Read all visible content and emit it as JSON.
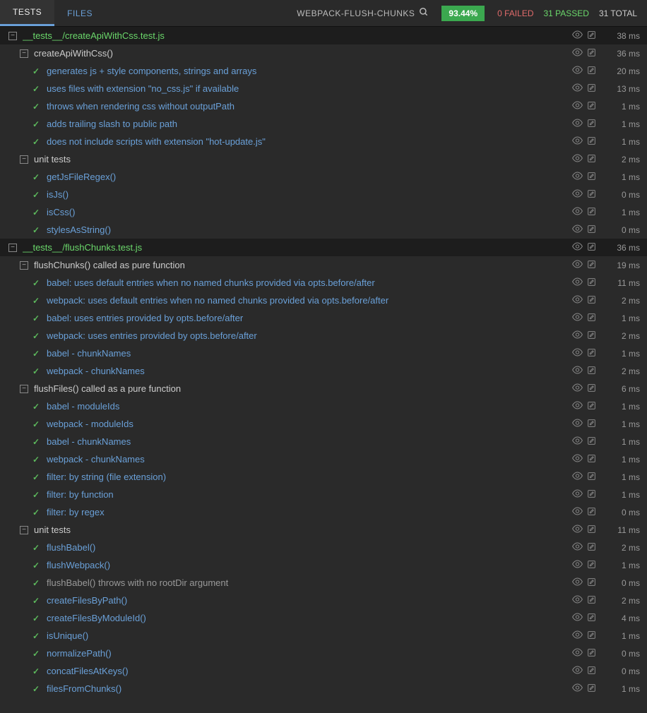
{
  "topbar": {
    "tabs": {
      "tests": "TESTS",
      "files": "FILES"
    },
    "project": "WEBPACK-FLUSH-CHUNKS",
    "coverage": "93.44%",
    "failed": "0 FAILED",
    "passed": "31 PASSED",
    "total": "31 TOTAL"
  },
  "tree": [
    {
      "id": "f0",
      "type": "file",
      "indent": 0,
      "label": "__tests__/createApiWithCss.test.js",
      "time": "38 ms"
    },
    {
      "id": "s0",
      "type": "suite",
      "indent": 1,
      "label": "createApiWithCss()",
      "time": "36 ms"
    },
    {
      "id": "t0",
      "type": "test",
      "indent": 2,
      "label": "generates js + style components, strings and arrays",
      "time": "20 ms"
    },
    {
      "id": "t1",
      "type": "test",
      "indent": 2,
      "label": "uses files with extension \"no_css.js\" if available",
      "time": "13 ms"
    },
    {
      "id": "t2",
      "type": "test",
      "indent": 2,
      "label": "throws when rendering css without outputPath",
      "time": "1 ms"
    },
    {
      "id": "t3",
      "type": "test",
      "indent": 2,
      "label": "adds trailing slash to public path",
      "time": "1 ms"
    },
    {
      "id": "t4",
      "type": "test",
      "indent": 2,
      "label": "does not include scripts with extension \"hot-update.js\"",
      "time": "1 ms"
    },
    {
      "id": "s1",
      "type": "suite",
      "indent": 1,
      "label": "unit tests",
      "time": "2 ms"
    },
    {
      "id": "t5",
      "type": "test",
      "indent": 2,
      "label": "getJsFileRegex()",
      "time": "1 ms"
    },
    {
      "id": "t6",
      "type": "test",
      "indent": 2,
      "label": "isJs()",
      "time": "0 ms"
    },
    {
      "id": "t7",
      "type": "test",
      "indent": 2,
      "label": "isCss()",
      "time": "1 ms"
    },
    {
      "id": "t8",
      "type": "test",
      "indent": 2,
      "label": "stylesAsString()",
      "time": "0 ms"
    },
    {
      "id": "f1",
      "type": "file",
      "indent": 0,
      "label": "__tests__/flushChunks.test.js",
      "time": "36 ms"
    },
    {
      "id": "s2",
      "type": "suite",
      "indent": 1,
      "label": "flushChunks() called as pure function",
      "time": "19 ms"
    },
    {
      "id": "t9",
      "type": "test",
      "indent": 2,
      "label": "babel: uses default entries when no named chunks provided via opts.before/after",
      "time": "11 ms"
    },
    {
      "id": "t10",
      "type": "test",
      "indent": 2,
      "label": "webpack: uses default entries when no named chunks provided via opts.before/after",
      "time": "2 ms"
    },
    {
      "id": "t11",
      "type": "test",
      "indent": 2,
      "label": "babel: uses entries provided by opts.before/after",
      "time": "1 ms"
    },
    {
      "id": "t12",
      "type": "test",
      "indent": 2,
      "label": "webpack: uses entries provided by opts.before/after",
      "time": "2 ms"
    },
    {
      "id": "t13",
      "type": "test",
      "indent": 2,
      "label": "babel - chunkNames",
      "time": "1 ms"
    },
    {
      "id": "t14",
      "type": "test",
      "indent": 2,
      "label": "webpack - chunkNames",
      "time": "2 ms"
    },
    {
      "id": "s3",
      "type": "suite",
      "indent": 1,
      "label": "flushFiles() called as a pure function",
      "time": "6 ms"
    },
    {
      "id": "t15",
      "type": "test",
      "indent": 2,
      "label": "babel - moduleIds",
      "time": "1 ms"
    },
    {
      "id": "t16",
      "type": "test",
      "indent": 2,
      "label": "webpack - moduleIds",
      "time": "1 ms"
    },
    {
      "id": "t17",
      "type": "test",
      "indent": 2,
      "label": "babel - chunkNames",
      "time": "1 ms"
    },
    {
      "id": "t18",
      "type": "test",
      "indent": 2,
      "label": "webpack - chunkNames",
      "time": "1 ms"
    },
    {
      "id": "t19",
      "type": "test",
      "indent": 2,
      "label": "filter: by string (file extension)",
      "time": "1 ms"
    },
    {
      "id": "t20",
      "type": "test",
      "indent": 2,
      "label": "filter: by function",
      "time": "1 ms"
    },
    {
      "id": "t21",
      "type": "test",
      "indent": 2,
      "label": "filter: by regex",
      "time": "0 ms"
    },
    {
      "id": "s4",
      "type": "suite",
      "indent": 1,
      "label": "unit tests",
      "time": "11 ms"
    },
    {
      "id": "t22",
      "type": "test",
      "indent": 2,
      "label": "flushBabel()",
      "time": "2 ms"
    },
    {
      "id": "t23",
      "type": "test",
      "indent": 2,
      "label": "flushWebpack()",
      "time": "1 ms"
    },
    {
      "id": "t24",
      "type": "test",
      "indent": 2,
      "muted": true,
      "label": "flushBabel() throws with no rootDir argument",
      "time": "0 ms"
    },
    {
      "id": "t25",
      "type": "test",
      "indent": 2,
      "label": "createFilesByPath()",
      "time": "2 ms"
    },
    {
      "id": "t26",
      "type": "test",
      "indent": 2,
      "label": "createFilesByModuleId()",
      "time": "4 ms"
    },
    {
      "id": "t27",
      "type": "test",
      "indent": 2,
      "label": "isUnique()",
      "time": "1 ms"
    },
    {
      "id": "t28",
      "type": "test",
      "indent": 2,
      "label": "normalizePath()",
      "time": "0 ms"
    },
    {
      "id": "t29",
      "type": "test",
      "indent": 2,
      "label": "concatFilesAtKeys()",
      "time": "0 ms"
    },
    {
      "id": "t30",
      "type": "test",
      "indent": 2,
      "label": "filesFromChunks()",
      "time": "1 ms"
    }
  ]
}
